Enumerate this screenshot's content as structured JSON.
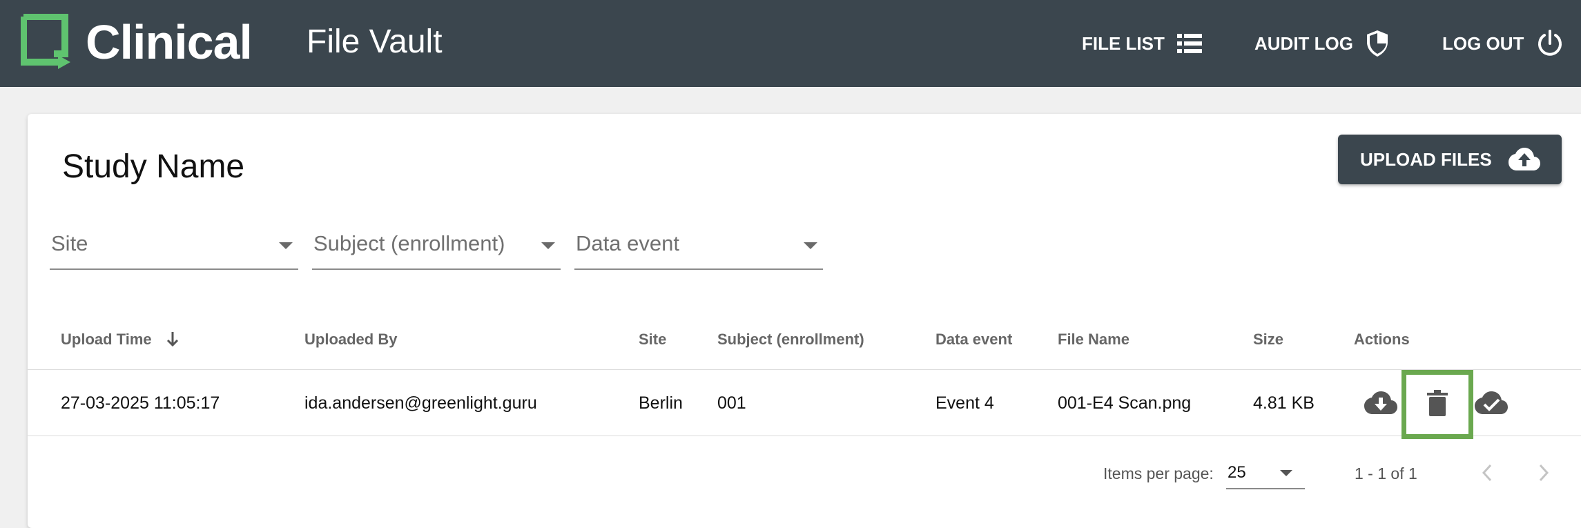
{
  "header": {
    "brand": "Clinical",
    "app_title": "File Vault",
    "nav": [
      {
        "label": "FILE LIST",
        "icon": "list-icon"
      },
      {
        "label": "AUDIT LOG",
        "icon": "shield-icon"
      },
      {
        "label": "LOG OUT",
        "icon": "power-icon"
      }
    ],
    "colors": {
      "bar": "#3b464e",
      "logo_accent": "#5fc36f"
    }
  },
  "main": {
    "study_title": "Study Name",
    "upload_button": {
      "label": "UPLOAD FILES",
      "icon": "cloud-upload-icon"
    },
    "filters": [
      {
        "label": "Site"
      },
      {
        "label": "Subject (enrollment)"
      },
      {
        "label": "Data event"
      }
    ],
    "table": {
      "columns": [
        {
          "label": "Upload Time",
          "sort": "descending"
        },
        {
          "label": "Uploaded By"
        },
        {
          "label": "Site"
        },
        {
          "label": "Subject (enrollment)"
        },
        {
          "label": "Data event"
        },
        {
          "label": "File Name"
        },
        {
          "label": "Size"
        },
        {
          "label": "Actions"
        }
      ],
      "rows": [
        {
          "upload_time": "27-03-2025 11:05:17",
          "uploaded_by": "ida.andersen@greenlight.guru",
          "site": "Berlin",
          "subject": "001",
          "data_event": "Event 4",
          "file_name": "001-E4 Scan.png",
          "size": "4.81 KB",
          "actions": [
            "cloud-download-icon",
            "trash-icon",
            "cloud-done-icon"
          ]
        }
      ]
    },
    "highlight_color": "#6aa84f",
    "pagination": {
      "items_per_page_label": "Items per page:",
      "items_per_page": "25",
      "range": "1 - 1 of 1"
    }
  }
}
